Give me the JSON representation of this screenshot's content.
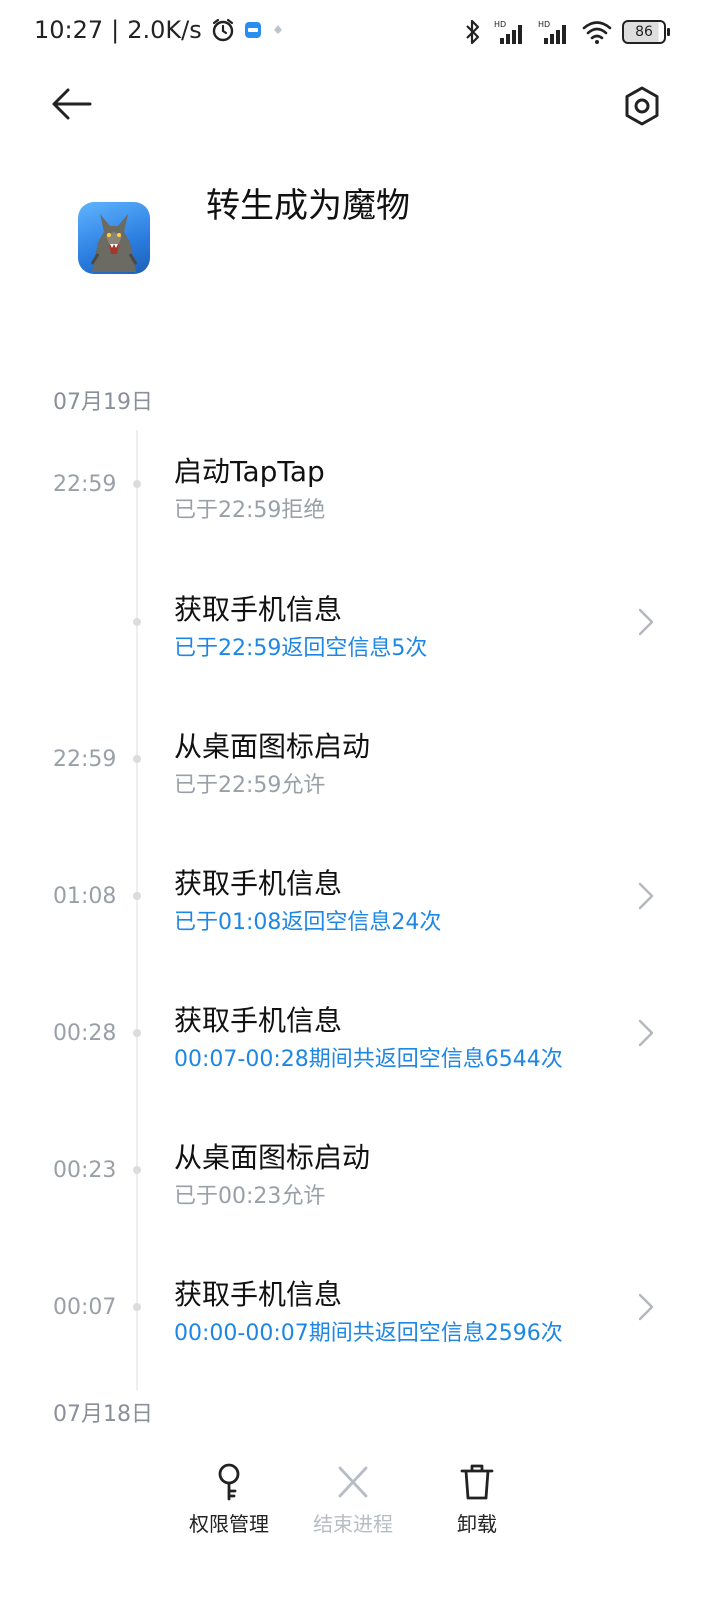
{
  "status_bar": {
    "time": "10:27",
    "separator": "|",
    "net_speed": "2.0K/s",
    "battery": "86",
    "icons": [
      "alarm-icon",
      "app-notification-icon",
      "dot-icon",
      "bluetooth-icon",
      "signal-hd-icon",
      "signal-hd-icon",
      "wifi-icon",
      "battery-icon"
    ]
  },
  "header": {
    "app_title": "转生成为魔物",
    "back_icon": "back-arrow-icon",
    "settings_icon": "settings-hexagon-icon",
    "app_icon": "werewolf-app-icon"
  },
  "timeline": {
    "date_1": "07月19日",
    "date_2": "07月18日",
    "entries": [
      {
        "time": "22:59",
        "title": "启动TapTap",
        "sub": "已于22:59拒绝",
        "sub_style": "gray",
        "has_chevron": false
      },
      {
        "time": "",
        "title": "获取手机信息",
        "sub": "已于22:59返回空信息5次",
        "sub_style": "blue",
        "has_chevron": true
      },
      {
        "time": "22:59",
        "title": "从桌面图标启动",
        "sub": "已于22:59允许",
        "sub_style": "gray",
        "has_chevron": false
      },
      {
        "time": "01:08",
        "title": "获取手机信息",
        "sub": "已于01:08返回空信息24次",
        "sub_style": "blue",
        "has_chevron": true
      },
      {
        "time": "00:28",
        "title": "获取手机信息",
        "sub": "00:07-00:28期间共返回空信息6544次",
        "sub_style": "blue",
        "has_chevron": true
      },
      {
        "time": "00:23",
        "title": "从桌面图标启动",
        "sub": "已于00:23允许",
        "sub_style": "gray",
        "has_chevron": false
      },
      {
        "time": "00:07",
        "title": "获取手机信息",
        "sub": "00:00-00:07期间共返回空信息2596次",
        "sub_style": "blue",
        "has_chevron": true
      }
    ]
  },
  "bottom_bar": {
    "permissions_label": "权限管理",
    "end_process_label": "结束进程",
    "uninstall_label": "卸载"
  },
  "colors": {
    "accent_blue": "#1e87e6",
    "muted_gray": "#9aa0a8",
    "disabled_gray": "#b8bcc4"
  }
}
